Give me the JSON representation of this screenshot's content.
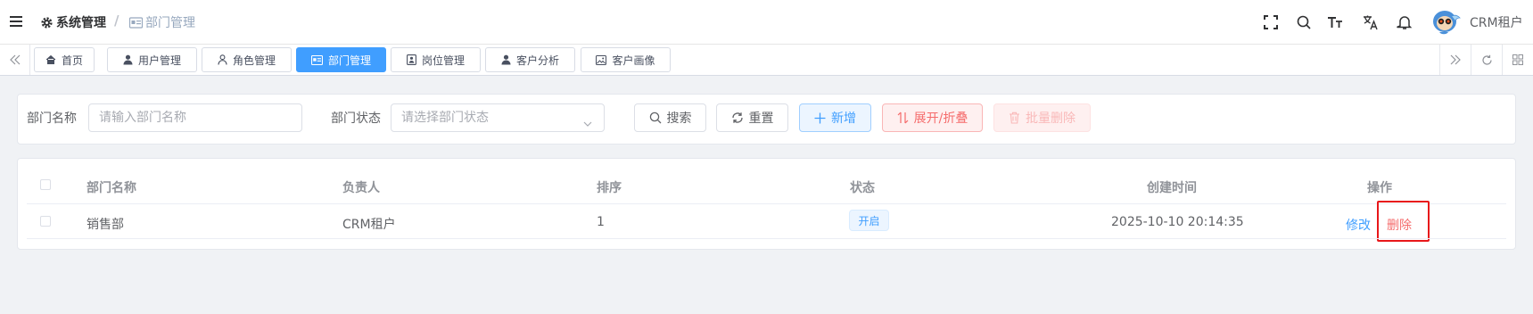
{
  "header": {
    "breadcrumb_root": "系统管理",
    "breadcrumb_current": "部门管理",
    "username": "CRM租户"
  },
  "tabs": [
    {
      "label": "首页",
      "icon": "home-icon",
      "active": false
    },
    {
      "label": "用户管理",
      "icon": "user-icon",
      "active": false
    },
    {
      "label": "角色管理",
      "icon": "user-outline-icon",
      "active": false
    },
    {
      "label": "部门管理",
      "icon": "id-card-icon",
      "active": true
    },
    {
      "label": "岗位管理",
      "icon": "badge-icon",
      "active": false
    },
    {
      "label": "客户分析",
      "icon": "user-icon",
      "active": false
    },
    {
      "label": "客户画像",
      "icon": "picture-icon",
      "active": false
    }
  ],
  "search": {
    "dept_name_label": "部门名称",
    "dept_name_placeholder": "请输入部门名称",
    "dept_status_label": "部门状态",
    "dept_status_placeholder": "请选择部门状态",
    "search_btn": "搜索",
    "reset_btn": "重置",
    "add_btn": "新增",
    "expand_btn": "展开/折叠",
    "batch_delete_btn": "批量删除"
  },
  "table": {
    "columns": [
      "部门名称",
      "负责人",
      "排序",
      "状态",
      "创建时间",
      "操作"
    ],
    "rows": [
      {
        "name": "销售部",
        "leader": "CRM租户",
        "sort": "1",
        "status": "开启",
        "created": "2025-10-10 20:14:35",
        "edit": "修改",
        "delete": "删除"
      }
    ]
  },
  "colors": {
    "primary": "#409eff",
    "danger": "#f56c6c",
    "highlight": "#e8171a"
  }
}
